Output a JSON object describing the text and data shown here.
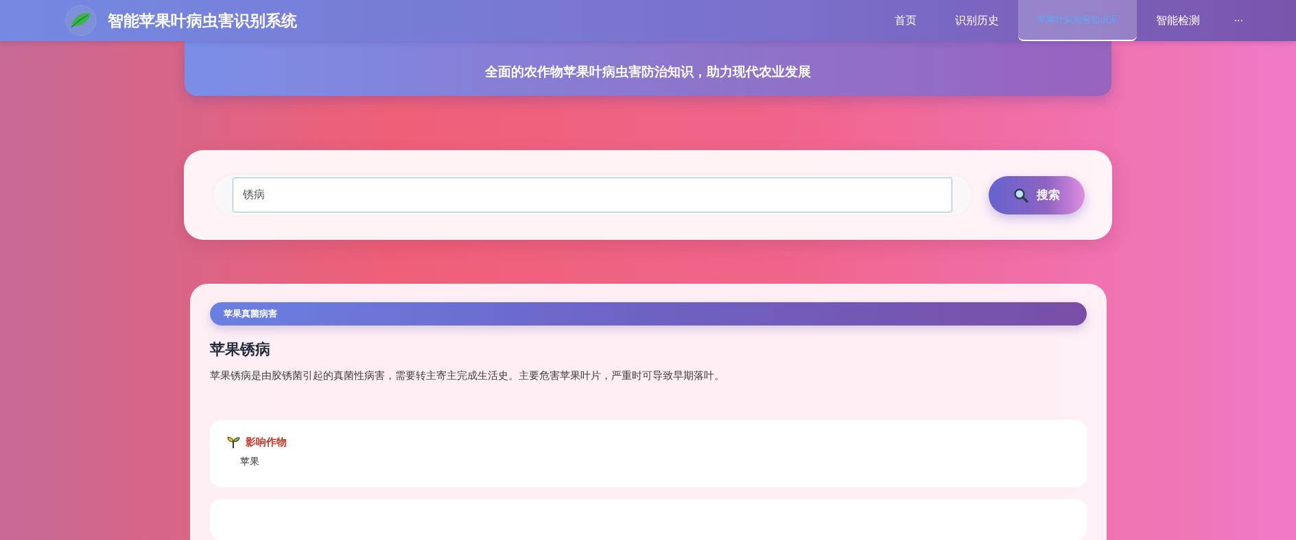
{
  "navbar": {
    "title": "智能苹果叶病虫害识别系统",
    "items": [
      {
        "label": "首页",
        "selected": false
      },
      {
        "label": "识别历史",
        "selected": false
      },
      {
        "label": "苹果叶病虫害知识库",
        "selected": true
      },
      {
        "label": "智能检测",
        "selected": false
      }
    ],
    "more": "···"
  },
  "hero": {
    "subtitle": "全面的农作物苹果叶病虫害防治知识，助力现代农业发展"
  },
  "search": {
    "value": "锈病",
    "button": "搜索"
  },
  "result": {
    "category": "苹果真菌病害",
    "title": "苹果锈病",
    "description": "苹果锈病是由胶锈菌引起的真菌性病害，需要转主寄主完成生活史。主要危害苹果叶片，严重时可导致早期落叶。",
    "sections": [
      {
        "label": "影响作物",
        "value": "苹果"
      }
    ]
  }
}
